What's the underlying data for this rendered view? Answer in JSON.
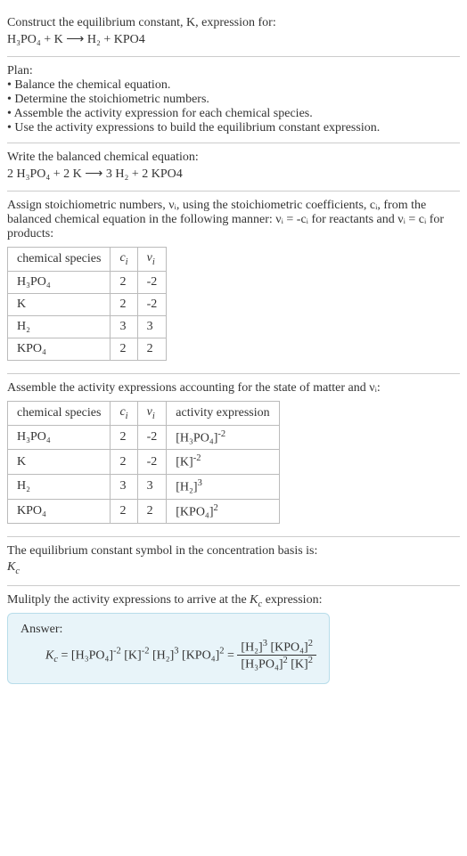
{
  "title_line1": "Construct the equilibrium constant, K, expression for:",
  "title_eq": "H₃PO₄ + K ⟶ H₂ + KPO4",
  "plan_header": "Plan:",
  "plan_items": [
    "• Balance the chemical equation.",
    "• Determine the stoichiometric numbers.",
    "• Assemble the activity expression for each chemical species.",
    "• Use the activity expressions to build the equilibrium constant expression."
  ],
  "balanced_header": "Write the balanced chemical equation:",
  "balanced_eq": "2 H₃PO₄ + 2 K ⟶ 3 H₂ + 2 KPO4",
  "stoich_intro_1": "Assign stoichiometric numbers, νᵢ, using the stoichiometric coefficients, cᵢ, from the balanced chemical equation in the following manner: νᵢ = -cᵢ for reactants and νᵢ = cᵢ for products:",
  "table1": {
    "headers": [
      "chemical species",
      "cᵢ",
      "νᵢ"
    ],
    "rows": [
      [
        "H₃PO₄",
        "2",
        "-2"
      ],
      [
        "K",
        "2",
        "-2"
      ],
      [
        "H₂",
        "3",
        "3"
      ],
      [
        "KPO₄",
        "2",
        "2"
      ]
    ]
  },
  "activity_intro": "Assemble the activity expressions accounting for the state of matter and νᵢ:",
  "table2": {
    "headers": [
      "chemical species",
      "cᵢ",
      "νᵢ",
      "activity expression"
    ],
    "rows": [
      {
        "species": "H₃PO₄",
        "c": "2",
        "v": "-2",
        "expr_base": "[H₃PO₄]",
        "expr_exp": "-2"
      },
      {
        "species": "K",
        "c": "2",
        "v": "-2",
        "expr_base": "[K]",
        "expr_exp": "-2"
      },
      {
        "species": "H₂",
        "c": "3",
        "v": "3",
        "expr_base": "[H₂]",
        "expr_exp": "3"
      },
      {
        "species": "KPO₄",
        "c": "2",
        "v": "2",
        "expr_base": "[KPO₄]",
        "expr_exp": "2"
      }
    ]
  },
  "symbol_intro": "The equilibrium constant symbol in the concentration basis is:",
  "symbol": "K",
  "symbol_sub": "c",
  "multiply_intro": "Mulitply the activity expressions to arrive at the Kc expression:",
  "answer_label": "Answer:",
  "answer": {
    "lhs_k": "K",
    "lhs_k_sub": "c",
    "eq1_parts": [
      {
        "base": "[H₃PO₄]",
        "exp": "-2"
      },
      {
        "base": "[K]",
        "exp": "-2"
      },
      {
        "base": "[H₂]",
        "exp": "3"
      },
      {
        "base": "[KPO₄]",
        "exp": "2"
      }
    ],
    "frac_num": [
      {
        "base": "[H₂]",
        "exp": "3"
      },
      {
        "base": "[KPO₄]",
        "exp": "2"
      }
    ],
    "frac_den": [
      {
        "base": "[H₃PO₄]",
        "exp": "2"
      },
      {
        "base": "[K]",
        "exp": "2"
      }
    ]
  },
  "chart_data": {
    "type": "table",
    "tables": [
      {
        "title": "Stoichiometric numbers",
        "columns": [
          "chemical species",
          "c_i",
          "ν_i"
        ],
        "rows": [
          [
            "H3PO4",
            2,
            -2
          ],
          [
            "K",
            2,
            -2
          ],
          [
            "H2",
            3,
            3
          ],
          [
            "KPO4",
            2,
            2
          ]
        ]
      },
      {
        "title": "Activity expressions",
        "columns": [
          "chemical species",
          "c_i",
          "ν_i",
          "activity expression"
        ],
        "rows": [
          [
            "H3PO4",
            2,
            -2,
            "[H3PO4]^-2"
          ],
          [
            "K",
            2,
            -2,
            "[K]^-2"
          ],
          [
            "H2",
            3,
            3,
            "[H2]^3"
          ],
          [
            "KPO4",
            2,
            2,
            "[KPO4]^2"
          ]
        ]
      }
    ]
  }
}
